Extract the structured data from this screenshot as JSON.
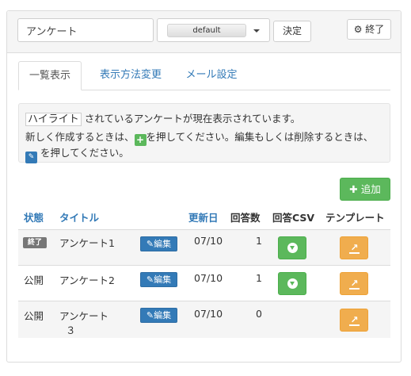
{
  "header": {
    "title_value": "アンケート",
    "select_value": "default",
    "decide_label": "決定",
    "exit_icon": "gear-icon",
    "exit_label": "終了"
  },
  "tabs": [
    {
      "label": "一覧表示",
      "active": true
    },
    {
      "label": "表示方法変更",
      "active": false
    },
    {
      "label": "メール設定",
      "active": false
    }
  ],
  "info": {
    "highlight_word": "ハイライト",
    "line1_rest": "されているアンケートが現在表示されています。",
    "line2_a": "新しく作成するときは、",
    "line2_b": "を押してください。編集もしくは削除するときは、",
    "line3_b": "を押してください。"
  },
  "add_label": "追加",
  "table": {
    "headers": {
      "status": "状態",
      "title": "タイトル",
      "updated": "更新日",
      "answers": "回答数",
      "csv": "回答CSV",
      "template": "テンプレート"
    },
    "edit_label": "編集",
    "rows": [
      {
        "status": "終了",
        "status_badge": true,
        "title": "アンケート1",
        "title_cont": "",
        "updated": "07/10",
        "answers": "1",
        "has_csv": true
      },
      {
        "status": "公開",
        "status_badge": false,
        "title": "アンケート2",
        "title_cont": "",
        "updated": "07/10",
        "answers": "1",
        "has_csv": true
      },
      {
        "status": "公開",
        "status_badge": false,
        "title": "アンケート",
        "title_cont": "３",
        "updated": "07/10",
        "answers": "0",
        "has_csv": false
      }
    ]
  },
  "colors": {
    "primary": "#337ab7",
    "success": "#5cb85c",
    "warning": "#f0ad4e",
    "badge": "#777777"
  }
}
